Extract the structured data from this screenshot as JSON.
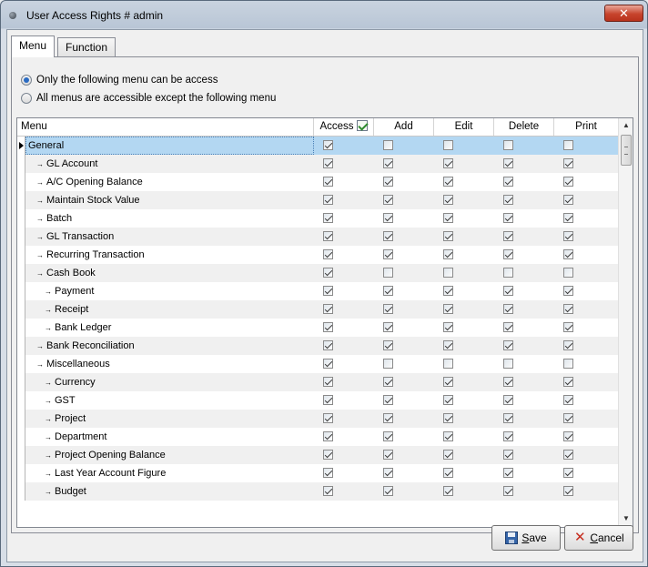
{
  "window": {
    "title": "User Access Rights # admin",
    "close_glyph": "✕"
  },
  "tabs": [
    {
      "label": "Menu",
      "active": true
    },
    {
      "label": "Function",
      "active": false
    }
  ],
  "access_mode": {
    "options": [
      {
        "label": "Only the following menu can be access",
        "selected": true
      },
      {
        "label": "All menus are accessible except the following menu",
        "selected": false
      }
    ]
  },
  "grid": {
    "columns": {
      "menu": "Menu",
      "access": "Access",
      "add": "Add",
      "edit": "Edit",
      "delete": "Delete",
      "print": "Print"
    },
    "access_header_checked": true,
    "rows": [
      {
        "label": "General",
        "level": 0,
        "selected": true,
        "access": true,
        "add": false,
        "edit": false,
        "delete": false,
        "print": false
      },
      {
        "label": "GL Account",
        "level": 1,
        "access": true,
        "add": true,
        "edit": true,
        "delete": true,
        "print": true
      },
      {
        "label": "A/C Opening Balance",
        "level": 1,
        "access": true,
        "add": true,
        "edit": true,
        "delete": true,
        "print": true
      },
      {
        "label": "Maintain Stock Value",
        "level": 1,
        "access": true,
        "add": true,
        "edit": true,
        "delete": true,
        "print": true
      },
      {
        "label": "Batch",
        "level": 1,
        "access": true,
        "add": true,
        "edit": true,
        "delete": true,
        "print": true
      },
      {
        "label": "GL Transaction",
        "level": 1,
        "access": true,
        "add": true,
        "edit": true,
        "delete": true,
        "print": true
      },
      {
        "label": "Recurring Transaction",
        "level": 1,
        "access": true,
        "add": true,
        "edit": true,
        "delete": true,
        "print": true
      },
      {
        "label": "Cash Book",
        "level": 1,
        "access": true,
        "add": false,
        "edit": false,
        "delete": false,
        "print": false
      },
      {
        "label": "Payment",
        "level": 2,
        "access": true,
        "add": true,
        "edit": true,
        "delete": true,
        "print": true
      },
      {
        "label": "Receipt",
        "level": 2,
        "access": true,
        "add": true,
        "edit": true,
        "delete": true,
        "print": true
      },
      {
        "label": "Bank Ledger",
        "level": 2,
        "access": true,
        "add": true,
        "edit": true,
        "delete": true,
        "print": true
      },
      {
        "label": "Bank Reconciliation",
        "level": 1,
        "access": true,
        "add": true,
        "edit": true,
        "delete": true,
        "print": true
      },
      {
        "label": "Miscellaneous",
        "level": 1,
        "access": true,
        "add": false,
        "edit": false,
        "delete": false,
        "print": false
      },
      {
        "label": "Currency",
        "level": 2,
        "access": true,
        "add": true,
        "edit": true,
        "delete": true,
        "print": true
      },
      {
        "label": "GST",
        "level": 2,
        "access": true,
        "add": true,
        "edit": true,
        "delete": true,
        "print": true
      },
      {
        "label": "Project",
        "level": 2,
        "access": true,
        "add": true,
        "edit": true,
        "delete": true,
        "print": true
      },
      {
        "label": "Department",
        "level": 2,
        "access": true,
        "add": true,
        "edit": true,
        "delete": true,
        "print": true
      },
      {
        "label": "Project Opening Balance",
        "level": 2,
        "access": true,
        "add": true,
        "edit": true,
        "delete": true,
        "print": true
      },
      {
        "label": "Last Year Account Figure",
        "level": 2,
        "access": true,
        "add": true,
        "edit": true,
        "delete": true,
        "print": true
      },
      {
        "label": "Budget",
        "level": 2,
        "access": true,
        "add": true,
        "edit": true,
        "delete": true,
        "print": true
      }
    ]
  },
  "buttons": {
    "save": {
      "prefix": "",
      "mnemonic": "S",
      "rest": "ave"
    },
    "cancel": {
      "prefix": "",
      "mnemonic": "C",
      "rest": "ancel"
    }
  },
  "icons": {
    "row_arrow": "→",
    "scroll_up": "▲",
    "scroll_down": "▼"
  }
}
